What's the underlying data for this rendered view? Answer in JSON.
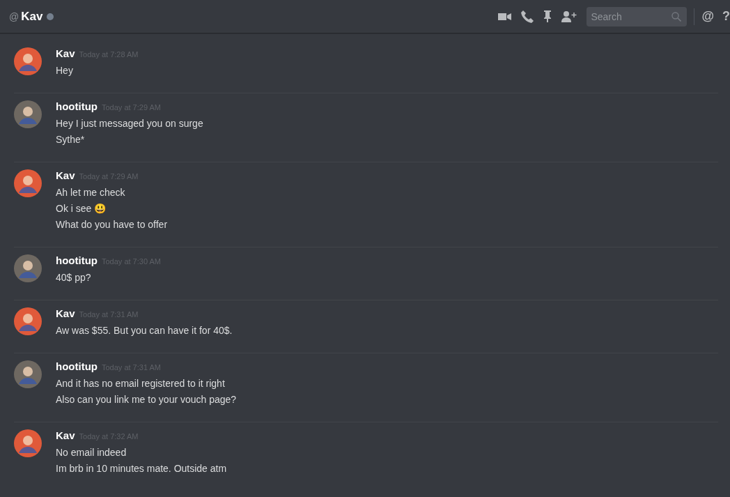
{
  "header": {
    "at": "@",
    "name": "Kav",
    "online": false,
    "search": {
      "placeholder": "Search"
    },
    "mention": "@",
    "help": "?"
  },
  "messages": [
    {
      "author": "Kav",
      "color": "#e05a3a",
      "time": "Today at 7:28 AM",
      "lines": [
        "Hey"
      ]
    },
    {
      "author": "hootitup",
      "color": "#6e6861",
      "time": "Today at 7:29 AM",
      "lines": [
        "Hey I just messaged you on surge",
        "Sythe*"
      ]
    },
    {
      "author": "Kav",
      "color": "#e05a3a",
      "time": "Today at 7:29 AM",
      "lines": [
        "Ah let me check",
        "Ok i see 😃",
        "What do you have to offer"
      ]
    },
    {
      "author": "hootitup",
      "color": "#6e6861",
      "time": "Today at 7:30 AM",
      "lines": [
        "40$ pp?"
      ]
    },
    {
      "author": "Kav",
      "color": "#e05a3a",
      "time": "Today at 7:31 AM",
      "lines": [
        "Aw was $55. But you can have it for 40$."
      ]
    },
    {
      "author": "hootitup",
      "color": "#6e6861",
      "time": "Today at 7:31 AM",
      "lines": [
        "And it has no email registered to it right",
        "Also can you link me to your vouch page?"
      ]
    },
    {
      "author": "Kav",
      "color": "#e05a3a",
      "time": "Today at 7:32 AM",
      "lines": [
        "No email indeed",
        "Im brb in 10 minutes mate. Outside atm"
      ]
    }
  ]
}
